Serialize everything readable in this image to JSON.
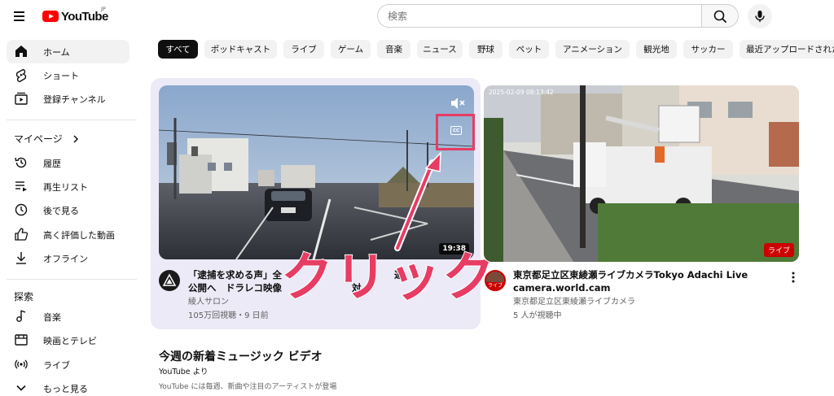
{
  "header": {
    "logo_text": "YouTube",
    "region": "JP",
    "search_placeholder": "検索"
  },
  "sidebar": {
    "main_items": [
      {
        "label": "ホーム",
        "icon": "home-icon",
        "active": true
      },
      {
        "label": "ショート",
        "icon": "shorts-icon"
      },
      {
        "label": "登録チャンネル",
        "icon": "subscriptions-icon"
      }
    ],
    "you_header": "マイページ",
    "you_items": [
      {
        "label": "履歴",
        "icon": "history-icon"
      },
      {
        "label": "再生リスト",
        "icon": "playlist-icon"
      },
      {
        "label": "後で見る",
        "icon": "watch-later-icon"
      },
      {
        "label": "高く評価した動画",
        "icon": "like-icon"
      },
      {
        "label": "オフライン",
        "icon": "download-icon"
      }
    ],
    "explore_header": "探索",
    "explore_items": [
      {
        "label": "音楽",
        "icon": "music-icon"
      },
      {
        "label": "映画とテレビ",
        "icon": "movie-icon"
      },
      {
        "label": "ライブ",
        "icon": "live-icon"
      },
      {
        "label": "もっと見る",
        "icon": "chevron-down-icon"
      }
    ]
  },
  "chips": [
    "すべて",
    "ポッドキャスト",
    "ライブ",
    "ゲーム",
    "音楽",
    "ニュース",
    "野球",
    "ペット",
    "アニメーション",
    "観光地",
    "サッカー",
    "最近アップロードされた"
  ],
  "videos": [
    {
      "title_line1": "「逮捕を求める声」全",
      "title_line1_end": "運",
      "title_line2": "公開へ　ドラレコ映像",
      "title_line2_end": "対",
      "channel": "綾人サロン",
      "stats": "105万回視聴・9 日前",
      "duration": "19:38"
    },
    {
      "title_line1": "東京都足立区東綾瀬ライブカメラTokyo Adachi Live",
      "title_line2": "camera.world.cam",
      "channel": "東京都足立区東綾瀬ライブカメラ",
      "stats": "5 人が視聴中",
      "live_label": "ライブ",
      "avatar_label": "ライブ",
      "timestamp": "2025-02-09 08:13:42"
    }
  ],
  "shelf": {
    "title": "今週の新着ミュージック ビデオ",
    "subtitle": "YouTube より",
    "description": "YouTube には毎週、新曲や注目のアーティストが登場"
  },
  "annotation": {
    "text": "クリック",
    "color": "#e73c63"
  },
  "colors": {
    "brand_red": "#ff0000",
    "hover_bg": "#eceaf6",
    "chip_bg": "#f2f2f2"
  }
}
